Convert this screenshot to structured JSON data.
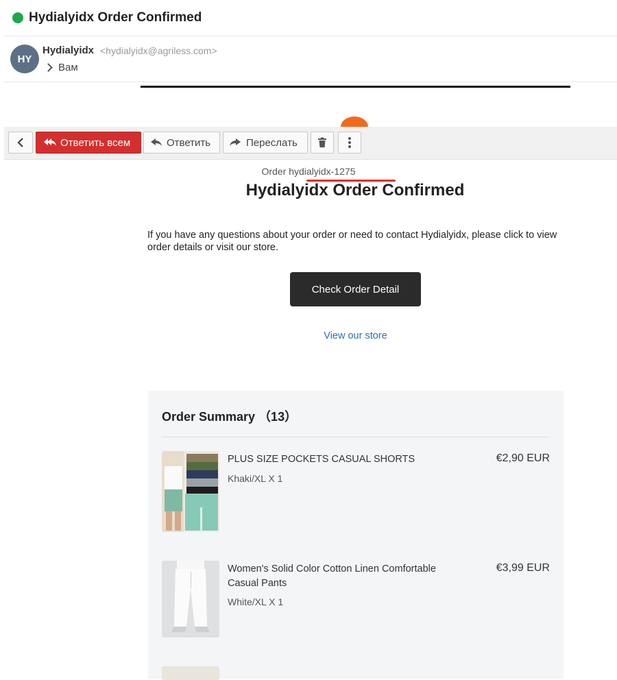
{
  "email": {
    "subject": "Hydialyidx Order Confirmed",
    "avatar_initials": "HY",
    "sender_name": "Hydialyidx",
    "sender_email": "<hydialyidx@agriless.com>",
    "recipient": "Вам"
  },
  "toolbar": {
    "reply_all": "Ответить всем",
    "reply": "Ответить",
    "forward": "Переслать"
  },
  "body": {
    "order_number": "Order hydialyidx-1275",
    "title": "Hydialyidx Order Confirmed",
    "intro": "If you have any questions about your order or need to contact Hydialyidx, please click to view order details or visit our store.",
    "cta_label": "Check Order Detail",
    "store_link": "View our store"
  },
  "summary": {
    "title": "Order Summary （13）",
    "items": [
      {
        "name": "PLUS SIZE POCKETS CASUAL SHORTS",
        "variant": "Khaki/XL X 1",
        "price": "€2,90 EUR"
      },
      {
        "name": "Women's Solid Color Cotton Linen Comfortable Casual Pants",
        "variant": "White/XL X 1",
        "price": "€3,99 EUR"
      }
    ]
  },
  "colors": {
    "status_dot": "#1fa84a",
    "reply_all_bg": "#d42f2f",
    "cta_bg": "#2b2b2b",
    "link": "#2f6eb0"
  }
}
